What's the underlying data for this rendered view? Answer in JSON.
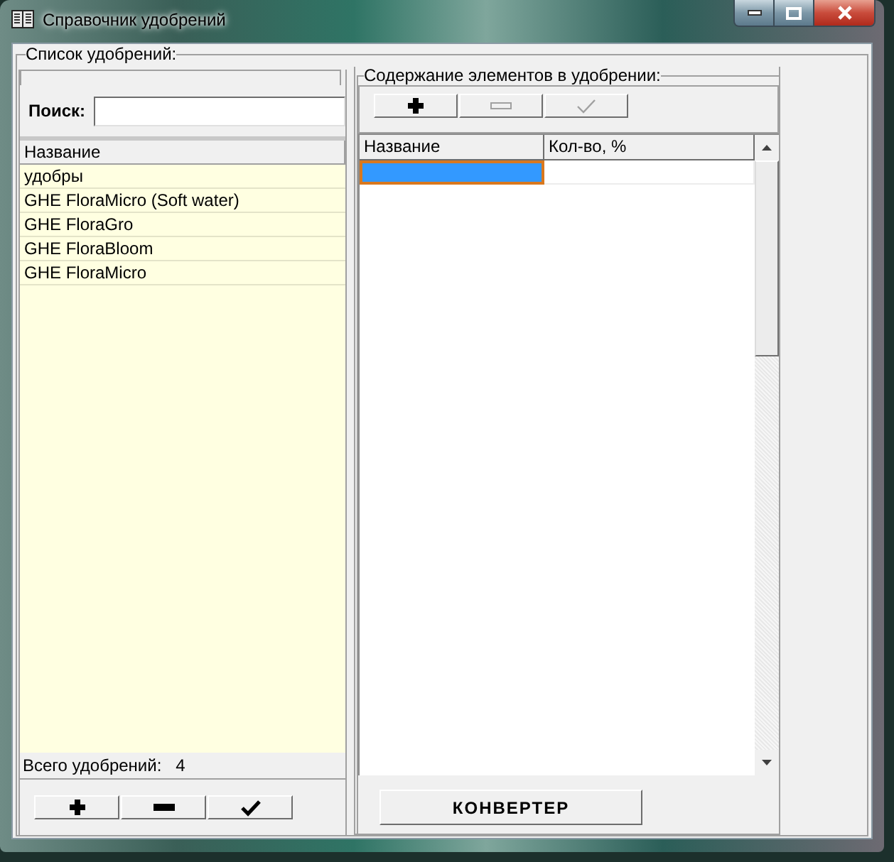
{
  "window": {
    "title": "Справочник удобрений"
  },
  "fertilizers": {
    "title": "Список удобрений:",
    "search": {
      "label": "Поиск:"
    },
    "table": {
      "columns": [
        "Название"
      ],
      "rows": [
        {
          "name": "удобры",
          "selected": false
        },
        {
          "name": "GHE FloraMicro (Soft water)",
          "selected": false
        },
        {
          "name": "GHE FloraGro",
          "selected": false
        },
        {
          "name": "GHE FloraBloom",
          "selected": false
        },
        {
          "name": "GHE FloraMicro",
          "selected": false
        }
      ]
    },
    "total": {
      "label": "Всего удобрений:",
      "value": "4"
    },
    "buttons": [
      {
        "kind": "add",
        "disabled": false
      },
      {
        "kind": "remove",
        "disabled": false
      },
      {
        "kind": "apply",
        "disabled": false
      }
    ]
  },
  "composition": {
    "title": "Содержание элементов в удобрении:",
    "toolbar": [
      {
        "kind": "add",
        "disabled": false
      },
      {
        "kind": "remove",
        "disabled": true
      },
      {
        "kind": "apply",
        "disabled": true
      }
    ],
    "table": {
      "columns": [
        "Название",
        "Кол-во, %"
      ],
      "rows": [
        {
          "cells": [
            {
              "selected": true
            },
            {
              "selected": false
            }
          ]
        }
      ]
    },
    "converter_button": {
      "label": "КОНВЕРТЕР"
    }
  }
}
